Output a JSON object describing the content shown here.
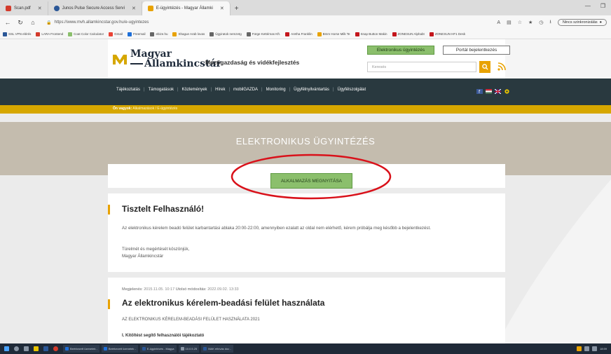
{
  "browser": {
    "tabs": [
      {
        "label": "Scan.pdf",
        "color": "#d33b2c"
      },
      {
        "label": "Junos Pulse Secure Access Servi",
        "color": "#2b5797"
      },
      {
        "label": "E-ügyintézés - Magyar Államki",
        "color": "#e8a200"
      }
    ],
    "new_tab": "+",
    "url": "https://www.mvh.allamkincstar.gov.hu/e-ugyintezes",
    "profile": "Nincs szinkronizálás",
    "bookmarks": [
      "SSL VPN elérés",
      "LARA Frontend",
      "Coat Color Calculator",
      "Gmail",
      "Freemail",
      "ebize.hu",
      "Shague Arab lovas",
      "Ügyiratok nemzetg",
      "Fürge Kettérnas Kft.",
      "Aretha Franklin",
      "Bmm Horse Milk Te",
      "Snap Button Makin",
      "ZONESUN Alphabt",
      "ZONESUN HF1 Desk"
    ]
  },
  "header": {
    "logo_line1": "Magyar",
    "logo_line2": "Államkincstár",
    "subtitle": "Mezőgazdaság és vidékfejlesztés",
    "btn_eugyintezes": "Elektronikus ügyintézés",
    "btn_portal": "Portál bejelentkezés",
    "search_placeholder": "Keresés"
  },
  "nav": {
    "items": [
      "Tájékoztatás",
      "Támogatások",
      "Közlemények",
      "Hírek",
      "mobilGAZDA",
      "Monitoring",
      "Ügyfélnyilvántartás",
      "Ügyfélszolgálat"
    ]
  },
  "breadcrumb": {
    "prefix": "Ön vagyok:",
    "path": "Alkalmazások / E-ügyintézés"
  },
  "hero": {
    "title": "ELEKTRONIKUS ÜGYINTÉZÉS",
    "open_button": "ALKALMAZÁS MEGNYITÁSA"
  },
  "notice": {
    "title": "Tisztelt Felhasználó!",
    "p1": "Az elektronikus kérelem beadó felület karbantartási ablaka 20:00-22:00, amennyiben ezalatt az oldal nem elérhető, kérem próbálja meg később a bejelentkezést.",
    "p2_line1": "Türelmét és megértését köszönjük,",
    "p2_line2": "Magyar Államkincstár"
  },
  "article": {
    "meta_published_label": "Megjelenés:",
    "meta_published": "2015.11.05. 10:17",
    "meta_modified_label": "Utolsó módosítás:",
    "meta_modified": "2022.09.02. 13:33",
    "title": "Az elektronikus kérelem-beadási felület használata",
    "subtitle": "AZ ELEKTRONIKUS KÉRELEM-BEADÁSI FELÜLET HASZNÁLATA 2021",
    "section": "I. Kitöltést segítő felhasználói tájékoztató"
  },
  "taskbar": {
    "apps": [
      "Beérkezett üzenetek -",
      "Beérkezett üzenetek -",
      "E-ügyintézés - Magya",
      "10.0.5.25",
      "MAK elhívás doc -"
    ],
    "time": "18:59"
  },
  "colors": {
    "green_button": "#8bbf6c",
    "nav_bg": "#29393f",
    "breadcrumb_bg": "#d6a700",
    "hero_bg": "#c4bcae",
    "accent": "#e8a200",
    "ring": "#d9111a"
  }
}
